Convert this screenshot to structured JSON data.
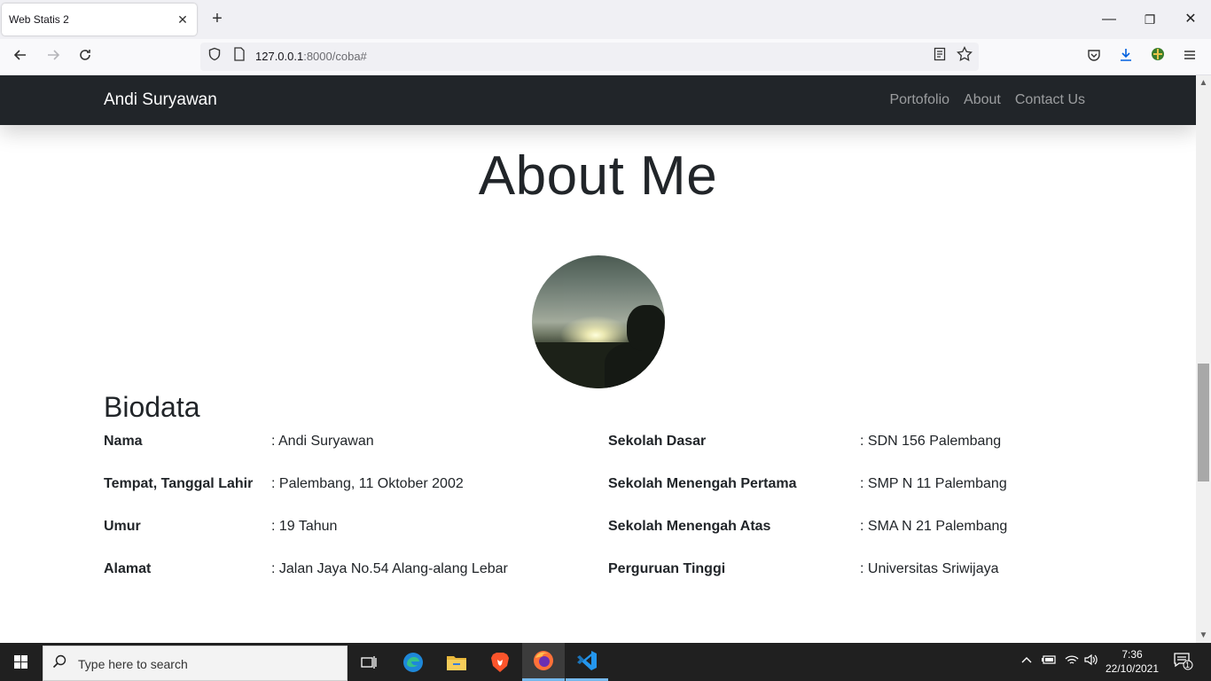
{
  "browser": {
    "tab_title": "Web Statis 2",
    "tab_close": "✕",
    "new_tab": "+",
    "url_host": "127.0.0.1",
    "url_rest": ":8000/coba#",
    "window_controls": {
      "minimize": "—",
      "restore": "❐",
      "close": "✕"
    }
  },
  "site": {
    "brand": "Andi Suryawan",
    "nav": [
      "Portofolio",
      "About",
      "Contact Us"
    ]
  },
  "about": {
    "title": "About Me",
    "biodata_title": "Biodata",
    "left": [
      {
        "label": "Nama",
        "value": ": Andi Suryawan"
      },
      {
        "label": "Tempat, Tanggal Lahir",
        "value": ": Palembang, 11 Oktober 2002"
      },
      {
        "label": "Umur",
        "value": ": 19 Tahun"
      },
      {
        "label": "Alamat",
        "value": ": Jalan Jaya No.54 Alang-alang Lebar"
      }
    ],
    "right": [
      {
        "label": "Sekolah Dasar",
        "value": ": SDN 156 Palembang"
      },
      {
        "label": "Sekolah Menengah Pertama",
        "value": ": SMP N 11 Palembang"
      },
      {
        "label": "Sekolah Menengah Atas",
        "value": ": SMA N 21 Palembang"
      },
      {
        "label": "Perguruan Tinggi",
        "value": ": Universitas Sriwijaya"
      }
    ]
  },
  "taskbar": {
    "search_placeholder": "Type here to search",
    "time": "7:36",
    "date": "22/10/2021",
    "notification_count": "1"
  },
  "colors": {
    "site_navbar": "#212529",
    "taskbar": "#202020",
    "accent": "#76b9ed"
  }
}
